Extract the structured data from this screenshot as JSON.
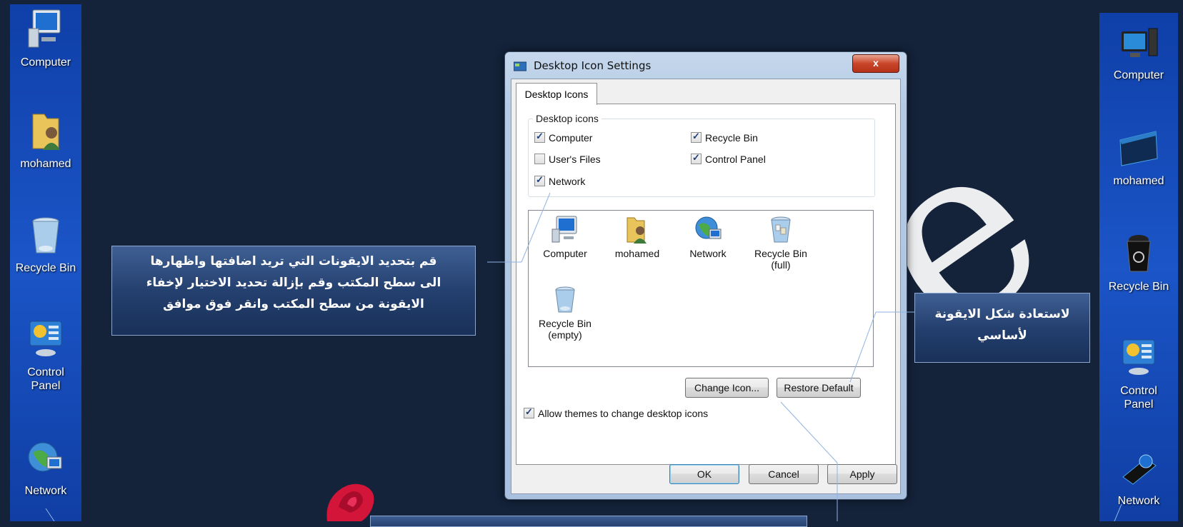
{
  "desktop_left": [
    {
      "label_lines": [
        "Computer"
      ],
      "icon": "computer-icon"
    },
    {
      "label_lines": [
        "mohamed"
      ],
      "icon": "user-folder-icon"
    },
    {
      "label_lines": [
        "Recycle Bin"
      ],
      "icon": "recycle-bin-icon"
    },
    {
      "label_lines": [
        "Control",
        "Panel"
      ],
      "icon": "control-panel-icon"
    },
    {
      "label_lines": [
        "Network"
      ],
      "icon": "network-icon"
    }
  ],
  "desktop_right": [
    {
      "label_lines": [
        "Computer"
      ],
      "icon": "computer-icon"
    },
    {
      "label_lines": [
        "mohamed"
      ],
      "icon": "user-folder-icon"
    },
    {
      "label_lines": [
        "Recycle Bin"
      ],
      "icon": "recycle-bin-icon"
    },
    {
      "label_lines": [
        "Control",
        "Panel"
      ],
      "icon": "control-panel-icon"
    },
    {
      "label_lines": [
        "Network"
      ],
      "icon": "network-icon"
    }
  ],
  "dialog": {
    "title": "Desktop Icon Settings",
    "close_label": "x",
    "tab_label": "Desktop Icons",
    "group_label": "Desktop icons",
    "checkboxes": [
      {
        "label": "Computer",
        "checked": true
      },
      {
        "label": "Recycle Bin",
        "checked": true
      },
      {
        "label": "User's Files",
        "checked": false
      },
      {
        "label": "Control Panel",
        "checked": true
      },
      {
        "label": "Network",
        "checked": true
      }
    ],
    "icon_list": [
      {
        "line1": "Computer",
        "line2": "",
        "icon": "computer-icon"
      },
      {
        "line1": "mohamed",
        "line2": "",
        "icon": "user-folder-icon"
      },
      {
        "line1": "Network",
        "line2": "",
        "icon": "network-icon"
      },
      {
        "line1": "Recycle Bin",
        "line2": "(full)",
        "icon": "recycle-bin-full-icon"
      },
      {
        "line1": "Recycle Bin",
        "line2": "(empty)",
        "icon": "recycle-bin-empty-icon"
      }
    ],
    "change_icon_label": "Change Icon...",
    "restore_default_label": "Restore Default",
    "allow_themes_label": "Allow themes to change desktop icons",
    "allow_themes_checked": true,
    "ok_label": "OK",
    "cancel_label": "Cancel",
    "apply_label": "Apply"
  },
  "callouts": {
    "left_lines": [
      "قم بتحديد الايقونات التي تريد اضافتها واظهارها",
      "الى سطح المكتب وقم بإزالة تحديد الاختيار لإخفاء",
      "الايقونة من سطح المكتب وانقر فوق موافق"
    ],
    "right_lines": [
      "لاستعادة شكل الايقونة",
      "لأساسي"
    ]
  },
  "colors": {
    "desktop_bg": "#14223a",
    "taskbar_blue": "#1b55c7",
    "callout_blue": "#24406f",
    "close_red": "#c9452a"
  }
}
